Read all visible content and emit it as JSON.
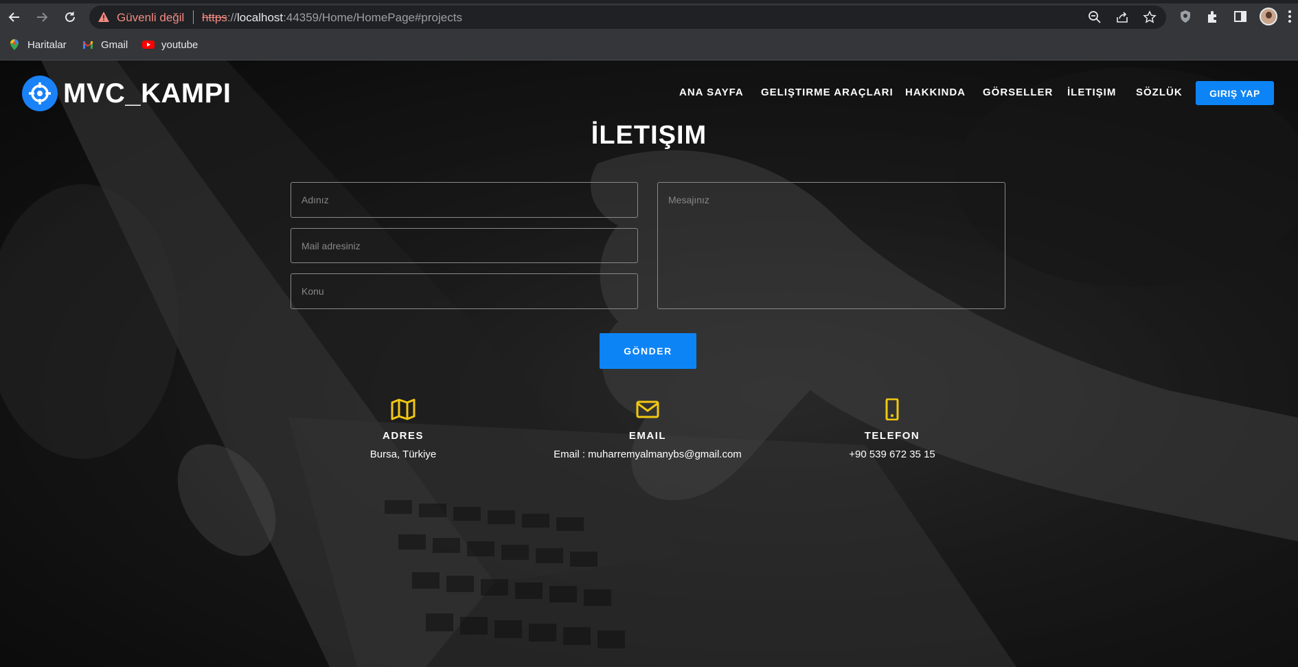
{
  "browser": {
    "security_text": "Güvenli değil",
    "url_scheme": "https",
    "url_sep": "://",
    "url_host": "localhost",
    "url_rest": ":44359/Home/HomePage#projects",
    "bookmarks": [
      {
        "label": "Haritalar",
        "icon": "maps-icon"
      },
      {
        "label": "Gmail",
        "icon": "gmail-icon"
      },
      {
        "label": "youtube",
        "icon": "youtube-icon"
      }
    ]
  },
  "site": {
    "brand": "MVC_KAMPI",
    "nav": [
      {
        "label": "ANA SAYFA"
      },
      {
        "label": "GELIŞTIRME ARAÇLARI"
      },
      {
        "label": "HAKKINDA"
      },
      {
        "label": "GÖRSELLER"
      },
      {
        "label": "İLETIŞIM"
      },
      {
        "label": "SÖZLÜK"
      }
    ],
    "login_label": "GIRIŞ YAP"
  },
  "contact": {
    "title": "İLETIŞIM",
    "name_placeholder": "Adınız",
    "mail_placeholder": "Mail adresiniz",
    "subject_placeholder": "Konu",
    "message_placeholder": "Mesajınız",
    "send_label": "GÖNDER",
    "info": [
      {
        "label": "ADRES",
        "value": "Bursa, Türkiye",
        "icon": "map-icon"
      },
      {
        "label": "EMAIL",
        "value": "Email : muharremyalmanybs@gmail.com",
        "icon": "envelope-icon"
      },
      {
        "label": "TELEFON",
        "value": "+90 539 672 35 15",
        "icon": "phone-icon"
      }
    ]
  },
  "colors": {
    "accent": "#0d84f5",
    "icon_yellow": "#f2c811",
    "warning_red": "#f28b82"
  }
}
